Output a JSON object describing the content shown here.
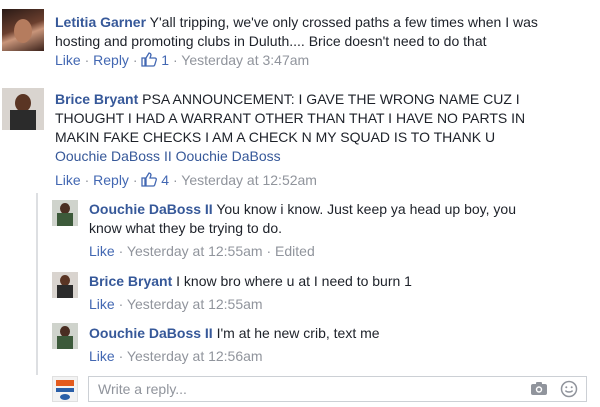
{
  "comments": [
    {
      "name": "Letitia Garner",
      "text_lines": [
        "Y'all tripping, we've only crossed paths a few times when I was",
        "hosting and promoting clubs in Duluth.... Brice doesn't need to do that"
      ],
      "like": "Like",
      "reply": "Reply",
      "likes": "1",
      "time": "Yesterday at 3:47am"
    },
    {
      "name": "Brice Bryant",
      "text_lines": [
        "PSA ANNOUNCEMENT: I GAVE THE WRONG NAME CUZ I",
        "THOUGHT I HAD A WARRANT OTHER THAN THAT I HAVE NO PARTS IN",
        "MAKIN FAKE CHECKS I AM A CHECK N MY SQUAD IS TO THANK U"
      ],
      "tags_line": "Oouchie DaBoss II Oouchie DaBoss",
      "like": "Like",
      "reply": "Reply",
      "likes": "4",
      "time": "Yesterday at 12:52am"
    }
  ],
  "replies": [
    {
      "name": "Oouchie DaBoss II",
      "text_lines": [
        "You know i know. Just keep ya head up boy, you",
        "know what they be trying to do."
      ],
      "like": "Like",
      "time": "Yesterday at 12:55am",
      "edited": "Edited"
    },
    {
      "name": "Brice Bryant",
      "text_lines": [
        "I know bro where u at I need to burn 1"
      ],
      "like": "Like",
      "time": "Yesterday at 12:55am"
    },
    {
      "name": "Oouchie DaBoss II",
      "text_lines": [
        "I'm at he new crib, text me"
      ],
      "like": "Like",
      "time": "Yesterday at 12:56am"
    }
  ],
  "reply_box": {
    "placeholder": "Write a reply..."
  },
  "colors": {
    "link": "#365899",
    "meta": "#90949c",
    "accent": "#4267b2"
  }
}
